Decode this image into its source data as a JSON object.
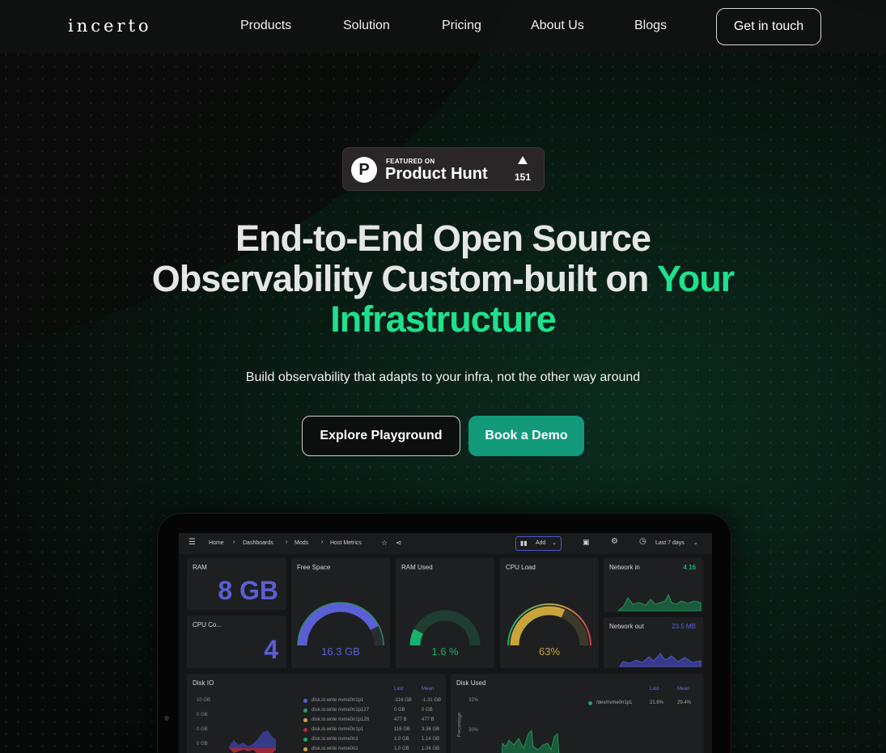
{
  "nav": {
    "logo": "incerto",
    "links": [
      "Products",
      "Solution",
      "Pricing",
      "About Us",
      "Blogs"
    ],
    "cta": "Get in touch"
  },
  "badge": {
    "small": "FEATURED ON",
    "big": "Product Hunt",
    "count": "151",
    "letter": "P"
  },
  "hero": {
    "line1": "End-to-End Open Source",
    "line2": "Observability Custom-built on",
    "accent1": "Your",
    "accent2": "Infrastructure",
    "subtitle": "Build observability that adapts to your infra, not the other way around",
    "btn_explore": "Explore Playground",
    "btn_demo": "Book a Demo"
  },
  "dashboard": {
    "breadcrumb": [
      "Home",
      "Dashboards",
      "Mods",
      "Host Metrics"
    ],
    "add_label": "Add",
    "time_range": "Last 7 days",
    "panels": {
      "ram": {
        "label": "RAM",
        "value": "8 GB"
      },
      "cpu_cores": {
        "label": "CPU Co...",
        "value": "4"
      },
      "free_space": {
        "label": "Free Space",
        "value": "16.3 GB",
        "fraction": 0.85
      },
      "ram_used": {
        "label": "RAM Used",
        "value": "1.6 %",
        "fraction": 0.12
      },
      "cpu_load": {
        "label": "CPU Load",
        "value": "63%",
        "fraction": 0.63
      },
      "network_in": {
        "label": "Network in",
        "value": "4.16"
      },
      "network_out": {
        "label": "Network out",
        "value": "23.5 MB"
      },
      "disk_io": {
        "label": "Disk IO",
        "yticks": [
          "10 GB",
          "0 GB",
          "0 GB",
          "0 GB"
        ]
      },
      "disk_used": {
        "label": "Disk Used",
        "yticks": [
          "32%",
          "30%"
        ],
        "ylabel": "Percentage"
      }
    },
    "disk_io_legend": {
      "headers": [
        "Last",
        "Mean"
      ],
      "rows": [
        [
          "disk.io.write nvme0n1p1",
          "-116 GB",
          "-1.31 GB"
        ],
        [
          "disk.io.write nvme0n1p127",
          "0 GB",
          "0 GB"
        ],
        [
          "disk.io.write nvme0n1p128",
          "477 B",
          "477 B"
        ],
        [
          "disk.io.write nvme0n1p1",
          "116 GB",
          "3.36 GB"
        ],
        [
          "disk.io.write nvme0n1",
          "1.0 GB",
          "1.14 GB"
        ],
        [
          "disk.io.write nvme0n1",
          "1.0 GB",
          "1.04 GB"
        ]
      ]
    },
    "disk_used_legend": {
      "headers": [
        "Last",
        "Mean"
      ],
      "rows": [
        [
          "/dev/nvme0n1p1",
          "21.6%",
          "29.4%"
        ]
      ]
    }
  },
  "colors": {
    "accent_green": "#1fe08c",
    "demo_button": "#129a7b",
    "gauge_purple": "#5b5fd6",
    "gauge_green": "#18b06a",
    "gauge_gold": "#c9a43a"
  }
}
